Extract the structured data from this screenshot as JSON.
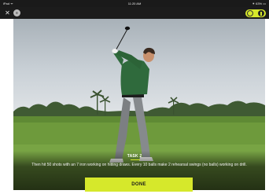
{
  "status_bar": {
    "left": "iPad ᯤ",
    "time": "11:20 AM",
    "right": "⁕ 63% ▭"
  },
  "app_bar": {
    "close_glyph": "✕",
    "menu_glyph": "≡"
  },
  "task": {
    "label": "TASK 2",
    "description": "Then hit 50 shots with an 7 iron working on hitting draws. Every 10 balls make 2 rehearsal swings (no balls) working on drill."
  },
  "done_button": {
    "label": "DONE"
  },
  "colors": {
    "accent": "#d6e82b",
    "bar": "#1c1c1c",
    "grass": "#6e9a3c",
    "shirt": "#2f6a3c"
  },
  "icons": {
    "close": "close-icon",
    "menu": "menu-icon",
    "toggle": "toggle-icon"
  }
}
